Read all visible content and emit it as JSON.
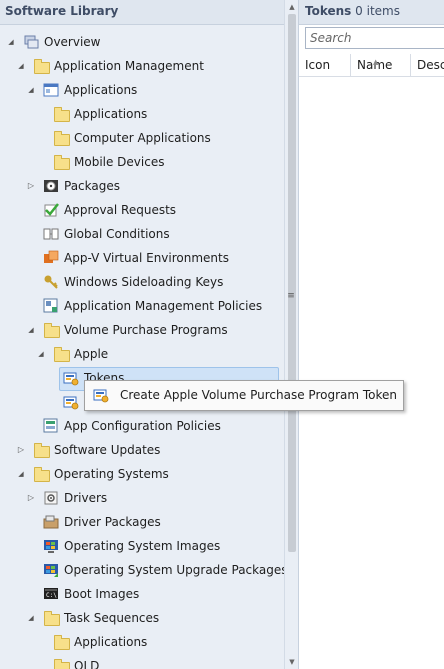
{
  "nav": {
    "title": "Software Library",
    "items": [
      {
        "label": "Overview",
        "level": 0,
        "arrow": "expanded",
        "icon": "overview-icon",
        "color": "#6b7fa8"
      },
      {
        "label": "Application Management",
        "level": 1,
        "arrow": "expanded",
        "icon": "folder-icon"
      },
      {
        "label": "Applications",
        "level": 2,
        "arrow": "expanded",
        "icon": "applications-icon",
        "color": "#4a78c2"
      },
      {
        "label": "Applications",
        "level": 3,
        "arrow": "none",
        "icon": "folder-icon"
      },
      {
        "label": "Computer Applications",
        "level": 3,
        "arrow": "none",
        "icon": "folder-icon"
      },
      {
        "label": "Mobile Devices",
        "level": 3,
        "arrow": "none",
        "icon": "folder-icon"
      },
      {
        "label": "Packages",
        "level": 2,
        "arrow": "collapsed",
        "icon": "package-icon",
        "color": "#5a4a2a"
      },
      {
        "label": "Approval Requests",
        "level": 2,
        "arrow": "none",
        "icon": "approval-icon",
        "color": "#3aa83a"
      },
      {
        "label": "Global Conditions",
        "level": 2,
        "arrow": "none",
        "icon": "global-conditions-icon",
        "color": "#777777"
      },
      {
        "label": "App-V Virtual Environments",
        "level": 2,
        "arrow": "none",
        "icon": "appv-icon",
        "color": "#e07020"
      },
      {
        "label": "Windows Sideloading Keys",
        "level": 2,
        "arrow": "none",
        "icon": "key-icon",
        "color": "#c8a030"
      },
      {
        "label": "Application Management Policies",
        "level": 2,
        "arrow": "none",
        "icon": "policy-icon",
        "color": "#5a7aa0"
      },
      {
        "label": "Volume Purchase Programs",
        "level": 2,
        "arrow": "expanded",
        "icon": "folder-icon"
      },
      {
        "label": "Apple",
        "level": 3,
        "arrow": "expanded",
        "icon": "folder-icon"
      },
      {
        "label": "Tokens",
        "level": 4,
        "arrow": "none",
        "icon": "token-icon",
        "color": "#3a6fc0",
        "selected": true
      },
      {
        "label": "",
        "level": 4,
        "arrow": "none",
        "icon": "token-license-icon",
        "color": "#3a6fc0"
      },
      {
        "label": "App Configuration Policies",
        "level": 2,
        "arrow": "none",
        "icon": "config-policy-icon",
        "color": "#3aa070"
      },
      {
        "label": "Software Updates",
        "level": 1,
        "arrow": "collapsed",
        "icon": "folder-icon"
      },
      {
        "label": "Operating Systems",
        "level": 1,
        "arrow": "expanded",
        "icon": "folder-icon"
      },
      {
        "label": "Drivers",
        "level": 2,
        "arrow": "collapsed",
        "icon": "driver-icon",
        "color": "#808080"
      },
      {
        "label": "Driver Packages",
        "level": 2,
        "arrow": "none",
        "icon": "driver-package-icon",
        "color": "#8a6a40"
      },
      {
        "label": "Operating System Images",
        "level": 2,
        "arrow": "none",
        "icon": "os-image-icon",
        "color": "#2a5aa8"
      },
      {
        "label": "Operating System Upgrade Packages",
        "level": 2,
        "arrow": "none",
        "icon": "os-upgrade-icon",
        "color": "#2a5aa8"
      },
      {
        "label": "Boot Images",
        "level": 2,
        "arrow": "none",
        "icon": "boot-image-icon",
        "color": "#202020"
      },
      {
        "label": "Task Sequences",
        "level": 2,
        "arrow": "expanded",
        "icon": "folder-icon"
      },
      {
        "label": "Applications",
        "level": 3,
        "arrow": "none",
        "icon": "folder-icon"
      },
      {
        "label": "OLD",
        "level": 3,
        "arrow": "none",
        "icon": "folder-icon"
      }
    ]
  },
  "list": {
    "title": "Tokens",
    "count": "0 items",
    "search_placeholder": "Search",
    "columns": [
      "Icon",
      "Name",
      "Descr"
    ]
  },
  "context_menu": {
    "items": [
      {
        "label": "Create Apple Volume Purchase Program Token",
        "icon": "token-icon"
      }
    ]
  },
  "colors": {
    "nav_background": "#e9eef5",
    "header_background": "#dfe6ef",
    "selection": "#cfe2f7",
    "folder": "#f7e08a"
  }
}
